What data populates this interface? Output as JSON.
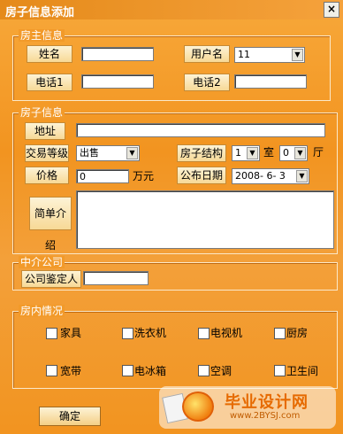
{
  "window": {
    "title": "房子信息添加",
    "close": "×"
  },
  "owner": {
    "legend": "房主信息",
    "name_label": "姓名",
    "username_label": "用户名",
    "username_value": "11",
    "phone1_label": "电话1",
    "phone2_label": "电话2"
  },
  "house": {
    "legend": "房子信息",
    "address_label": "地址",
    "trade_label": "交易等级",
    "trade_value": "出售",
    "structure_label": "房子结构",
    "rooms_value": "1",
    "room_unit": "室",
    "halls_value": "0",
    "hall_unit": "厅",
    "price_label": "价格",
    "price_value": "0",
    "price_unit": "万元",
    "date_label": "公布日期",
    "date_value": "2008- 6- 3",
    "intro_label": "简单介绍"
  },
  "agency": {
    "legend": "中介公司",
    "appraiser_label": "公司鉴定人"
  },
  "facilities": {
    "legend": "房内情况",
    "items": [
      "家具",
      "洗衣机",
      "电视机",
      "厨房",
      "宽带",
      "电冰箱",
      "空调",
      "卫生间"
    ]
  },
  "buttons": {
    "confirm": "确定"
  },
  "watermark": {
    "title": "毕业设计网",
    "url": "www.2BYSJ.com"
  }
}
